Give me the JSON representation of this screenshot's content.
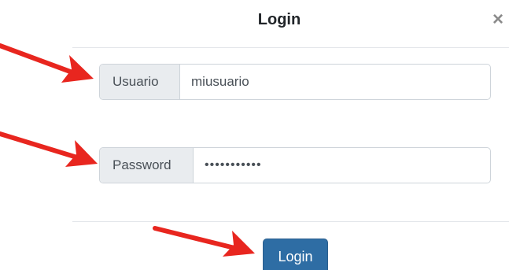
{
  "modal": {
    "title": "Login",
    "close_symbol": "×"
  },
  "username": {
    "label": "Usuario",
    "value": "miusuario"
  },
  "password": {
    "label": "Password",
    "value": "•••••••••••"
  },
  "submit": {
    "label": "Login"
  },
  "colors": {
    "arrow": "#e8261f",
    "button_bg": "#2e6da4",
    "addon_bg": "#e9ecef"
  },
  "annotations": {
    "arrow_icon": "red-arrow-icon",
    "arrow_count": 3
  }
}
